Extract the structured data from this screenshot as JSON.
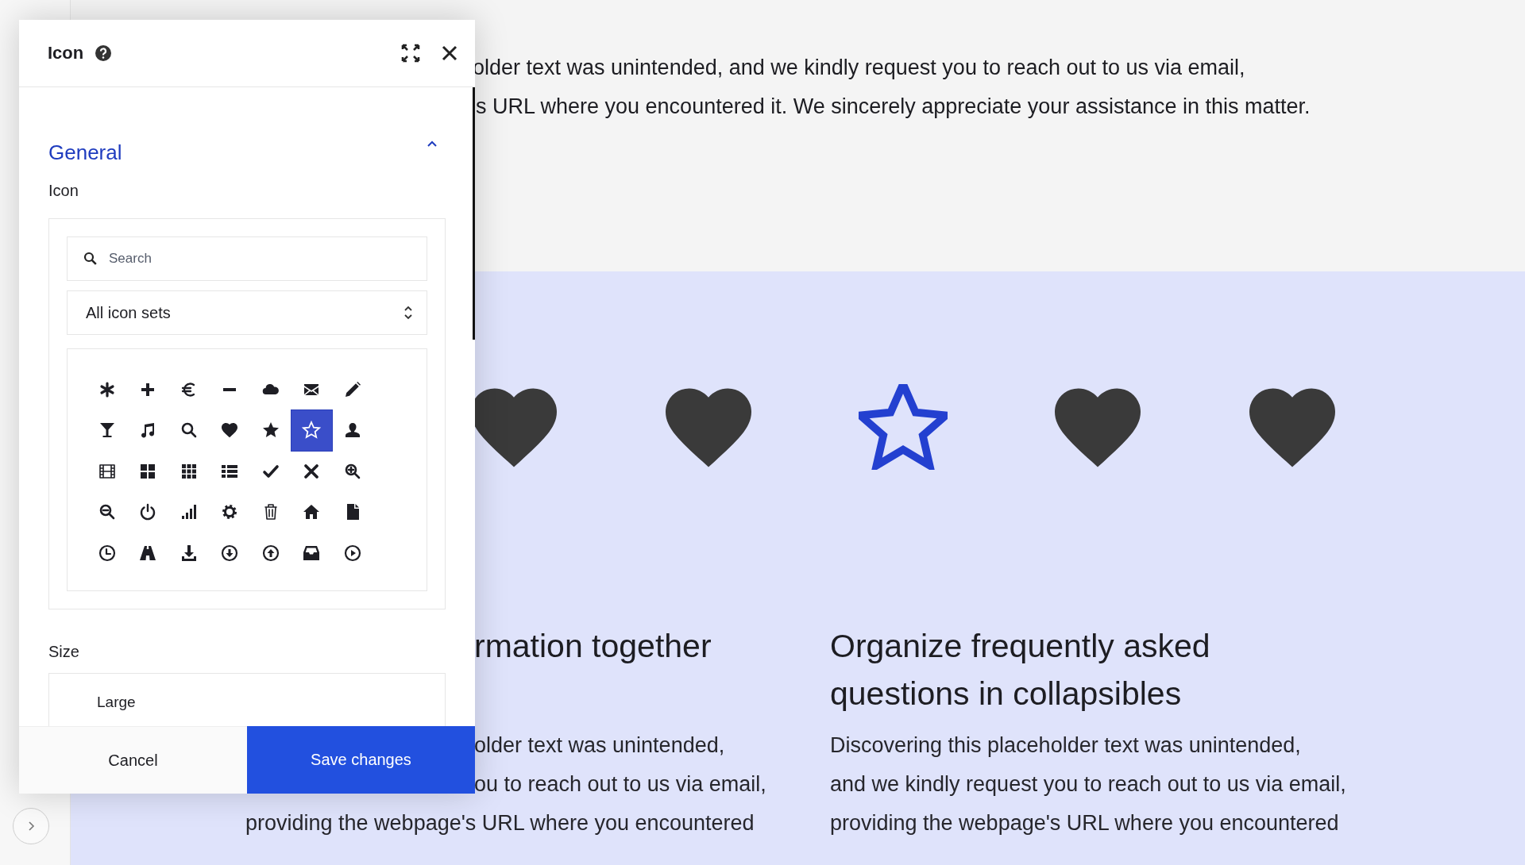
{
  "background": {
    "intro_lines": [
      "older text was unintended, and we kindly request you to reach out to us via email,",
      "s URL where you encountered it. We sincerely appreciate your assistance in this matter."
    ],
    "preview_icons": [
      {
        "kind": "heart",
        "color": "#3a3a3a"
      },
      {
        "kind": "heart",
        "color": "#3a3a3a"
      },
      {
        "kind": "star-outline",
        "color": "#2340d0"
      },
      {
        "kind": "heart",
        "color": "#3a3a3a"
      },
      {
        "kind": "heart",
        "color": "#3a3a3a"
      }
    ],
    "columns": [
      {
        "clipped_heading_lines": [
          "rmation together"
        ],
        "clipped_body_lines": [
          "older text was unintended,",
          "ou to reach out to us via email,"
        ],
        "body_lines": [
          "providing the webpage's URL where you encountered"
        ]
      },
      {
        "heading_lines": [
          "Organize frequently asked",
          "questions in collapsibles"
        ],
        "body_lines": [
          "Discovering this placeholder text was unintended,",
          "and we kindly request you to reach out to us via email,",
          "providing the webpage's URL where you encountered"
        ]
      }
    ]
  },
  "dialog": {
    "title": "Icon",
    "section": {
      "title": "General",
      "expanded": true
    },
    "icon_label": "Icon",
    "search": {
      "placeholder": "Search"
    },
    "icon_set": "All icon sets",
    "icons": [
      {
        "kind": "asterisk",
        "selected": false
      },
      {
        "kind": "plus",
        "selected": false
      },
      {
        "kind": "euro",
        "selected": false
      },
      {
        "kind": "minus",
        "selected": false
      },
      {
        "kind": "cloud",
        "selected": false
      },
      {
        "kind": "envelope",
        "selected": false
      },
      {
        "kind": "pencil",
        "selected": false
      },
      {
        "kind": "glass",
        "selected": false
      },
      {
        "kind": "music",
        "selected": false
      },
      {
        "kind": "search",
        "selected": false
      },
      {
        "kind": "heart",
        "selected": false
      },
      {
        "kind": "star",
        "selected": false
      },
      {
        "kind": "star-outline",
        "selected": true
      },
      {
        "kind": "user",
        "selected": false
      },
      {
        "kind": "film",
        "selected": false
      },
      {
        "kind": "th-large",
        "selected": false
      },
      {
        "kind": "th",
        "selected": false
      },
      {
        "kind": "list",
        "selected": false
      },
      {
        "kind": "check",
        "selected": false
      },
      {
        "kind": "close",
        "selected": false
      },
      {
        "kind": "zoom-in",
        "selected": false
      },
      {
        "kind": "zoom-out",
        "selected": false
      },
      {
        "kind": "power",
        "selected": false
      },
      {
        "kind": "signal",
        "selected": false
      },
      {
        "kind": "gear",
        "selected": false
      },
      {
        "kind": "trash",
        "selected": false
      },
      {
        "kind": "home",
        "selected": false
      },
      {
        "kind": "file",
        "selected": false
      },
      {
        "kind": "clock",
        "selected": false
      },
      {
        "kind": "road",
        "selected": false
      },
      {
        "kind": "download",
        "selected": false
      },
      {
        "kind": "circle-down",
        "selected": false
      },
      {
        "kind": "circle-up",
        "selected": false
      },
      {
        "kind": "inbox",
        "selected": false
      },
      {
        "kind": "circle-play",
        "selected": false
      }
    ],
    "size_label": "Size",
    "size_value": "Large",
    "buttons": [
      {
        "label": "Cancel",
        "kind": "secondary"
      },
      {
        "label": "Save changes",
        "kind": "primary"
      }
    ]
  }
}
